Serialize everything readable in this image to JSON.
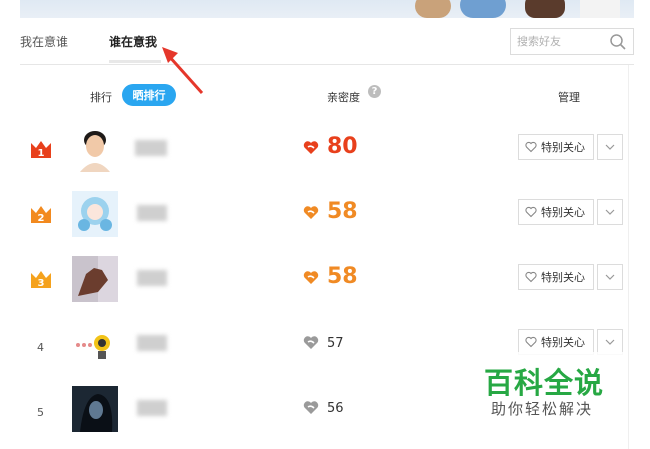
{
  "tabs": [
    {
      "label": "我在意谁"
    },
    {
      "label": "谁在意我"
    }
  ],
  "search": {
    "placeholder": "搜索好友"
  },
  "header": {
    "rank_label": "排行",
    "share_button": "晒排行",
    "intimacy_label": "亲密度",
    "help_symbol": "?",
    "manage_label": "管理"
  },
  "rows": [
    {
      "rank": "1",
      "score": "80",
      "care_label": "特别关心",
      "rank_style": "crown-red",
      "score_color": "#e8401c"
    },
    {
      "rank": "2",
      "score": "58",
      "care_label": "特别关心",
      "rank_style": "crown-orange",
      "score_color": "#f08a24"
    },
    {
      "rank": "3",
      "score": "58",
      "care_label": "特别关心",
      "rank_style": "crown-yellow",
      "score_color": "#f08a24"
    },
    {
      "rank": "4",
      "score": "57",
      "care_label": "特别关心",
      "rank_style": "plain",
      "score_color": "#333333"
    },
    {
      "rank": "5",
      "score": "56",
      "care_label": "特别关心",
      "rank_style": "plain",
      "score_color": "#333333"
    }
  ],
  "watermark": {
    "title": "百科全说",
    "subtitle": "助你轻松解决"
  }
}
